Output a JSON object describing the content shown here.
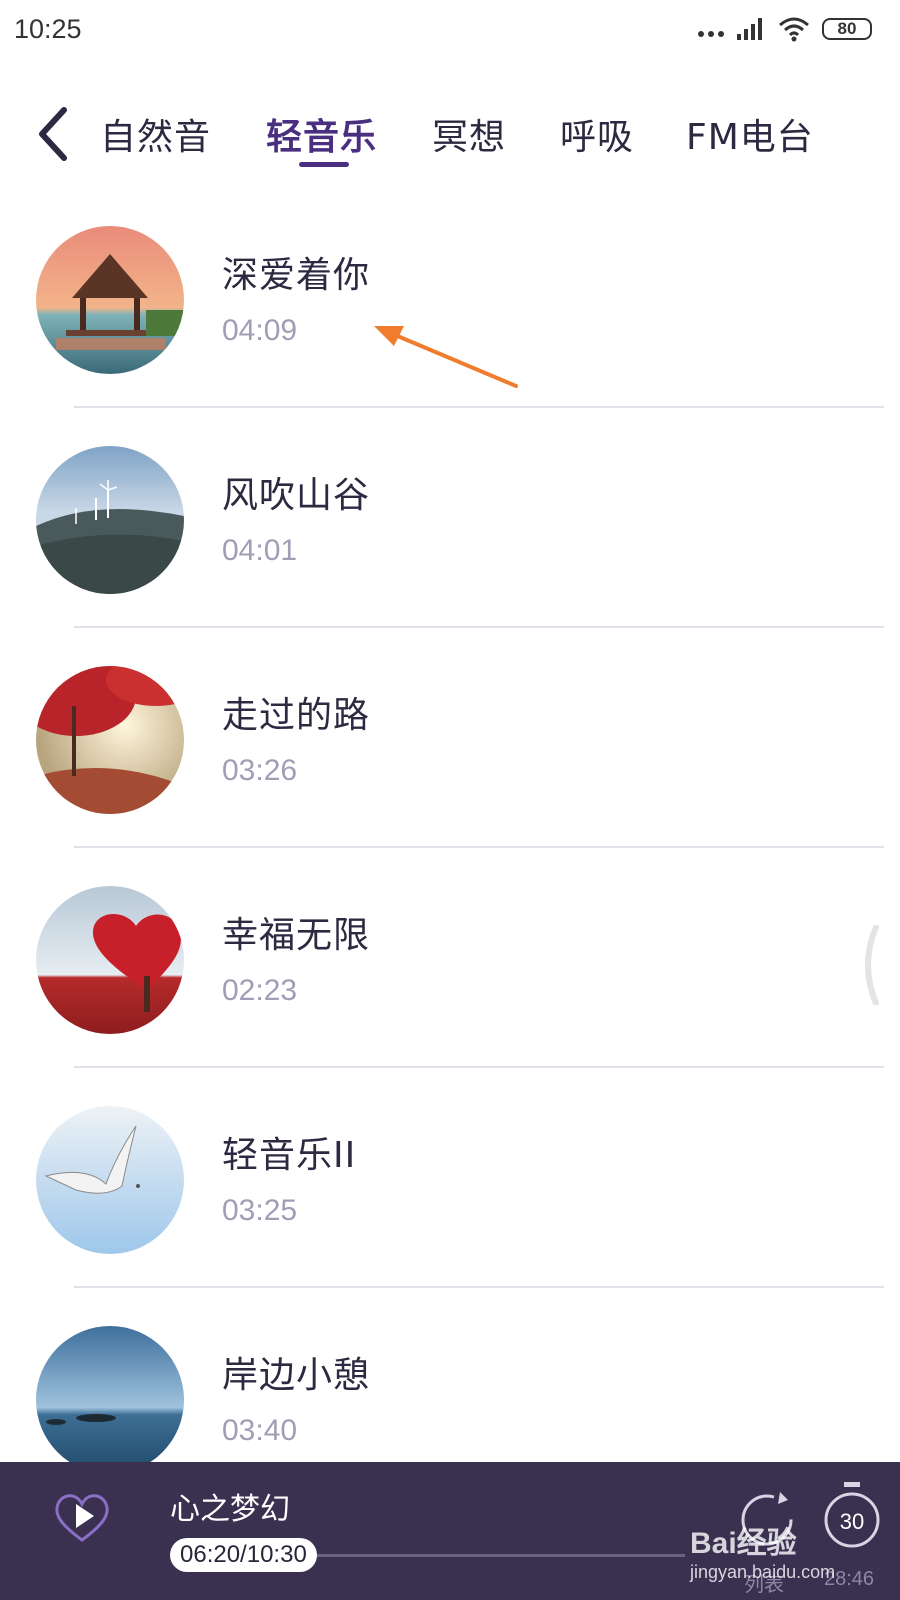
{
  "status_bar": {
    "time": "10:25",
    "battery": "80",
    "icons": [
      "dots-icon",
      "signal-icon",
      "wifi-icon",
      "battery-icon"
    ]
  },
  "tabs": {
    "back_icon": "chevron-left-icon",
    "items": [
      {
        "label": "自然音",
        "active": false
      },
      {
        "label": "轻音乐",
        "active": true
      },
      {
        "label": "冥想",
        "active": false
      },
      {
        "label": "呼吸",
        "active": false
      },
      {
        "label": "FM电台",
        "active": false
      }
    ],
    "active_color": "#4a2f80"
  },
  "tracks": [
    {
      "title": "深爱着你",
      "duration": "04:09",
      "thumb": "pavilion-sunset"
    },
    {
      "title": "风吹山谷",
      "duration": "04:01",
      "thumb": "wind-turbines-hill"
    },
    {
      "title": "走过的路",
      "duration": "03:26",
      "thumb": "autumn-path"
    },
    {
      "title": "幸福无限",
      "duration": "02:23",
      "thumb": "heart-tree"
    },
    {
      "title": "轻音乐II",
      "duration": "03:25",
      "thumb": "seagull-sky"
    },
    {
      "title": "岸边小憩",
      "duration": "03:40",
      "thumb": "seashore"
    }
  ],
  "player": {
    "now_playing": "心之梦幻",
    "time": "06:20/10:30",
    "progress": 0.6,
    "list_label": "列表",
    "timer_badge": "30",
    "timer_remaining": "28:46",
    "background": "#3a3050"
  },
  "watermark": {
    "logo": "Bai经验",
    "url": "jingyan.baidu.com"
  }
}
